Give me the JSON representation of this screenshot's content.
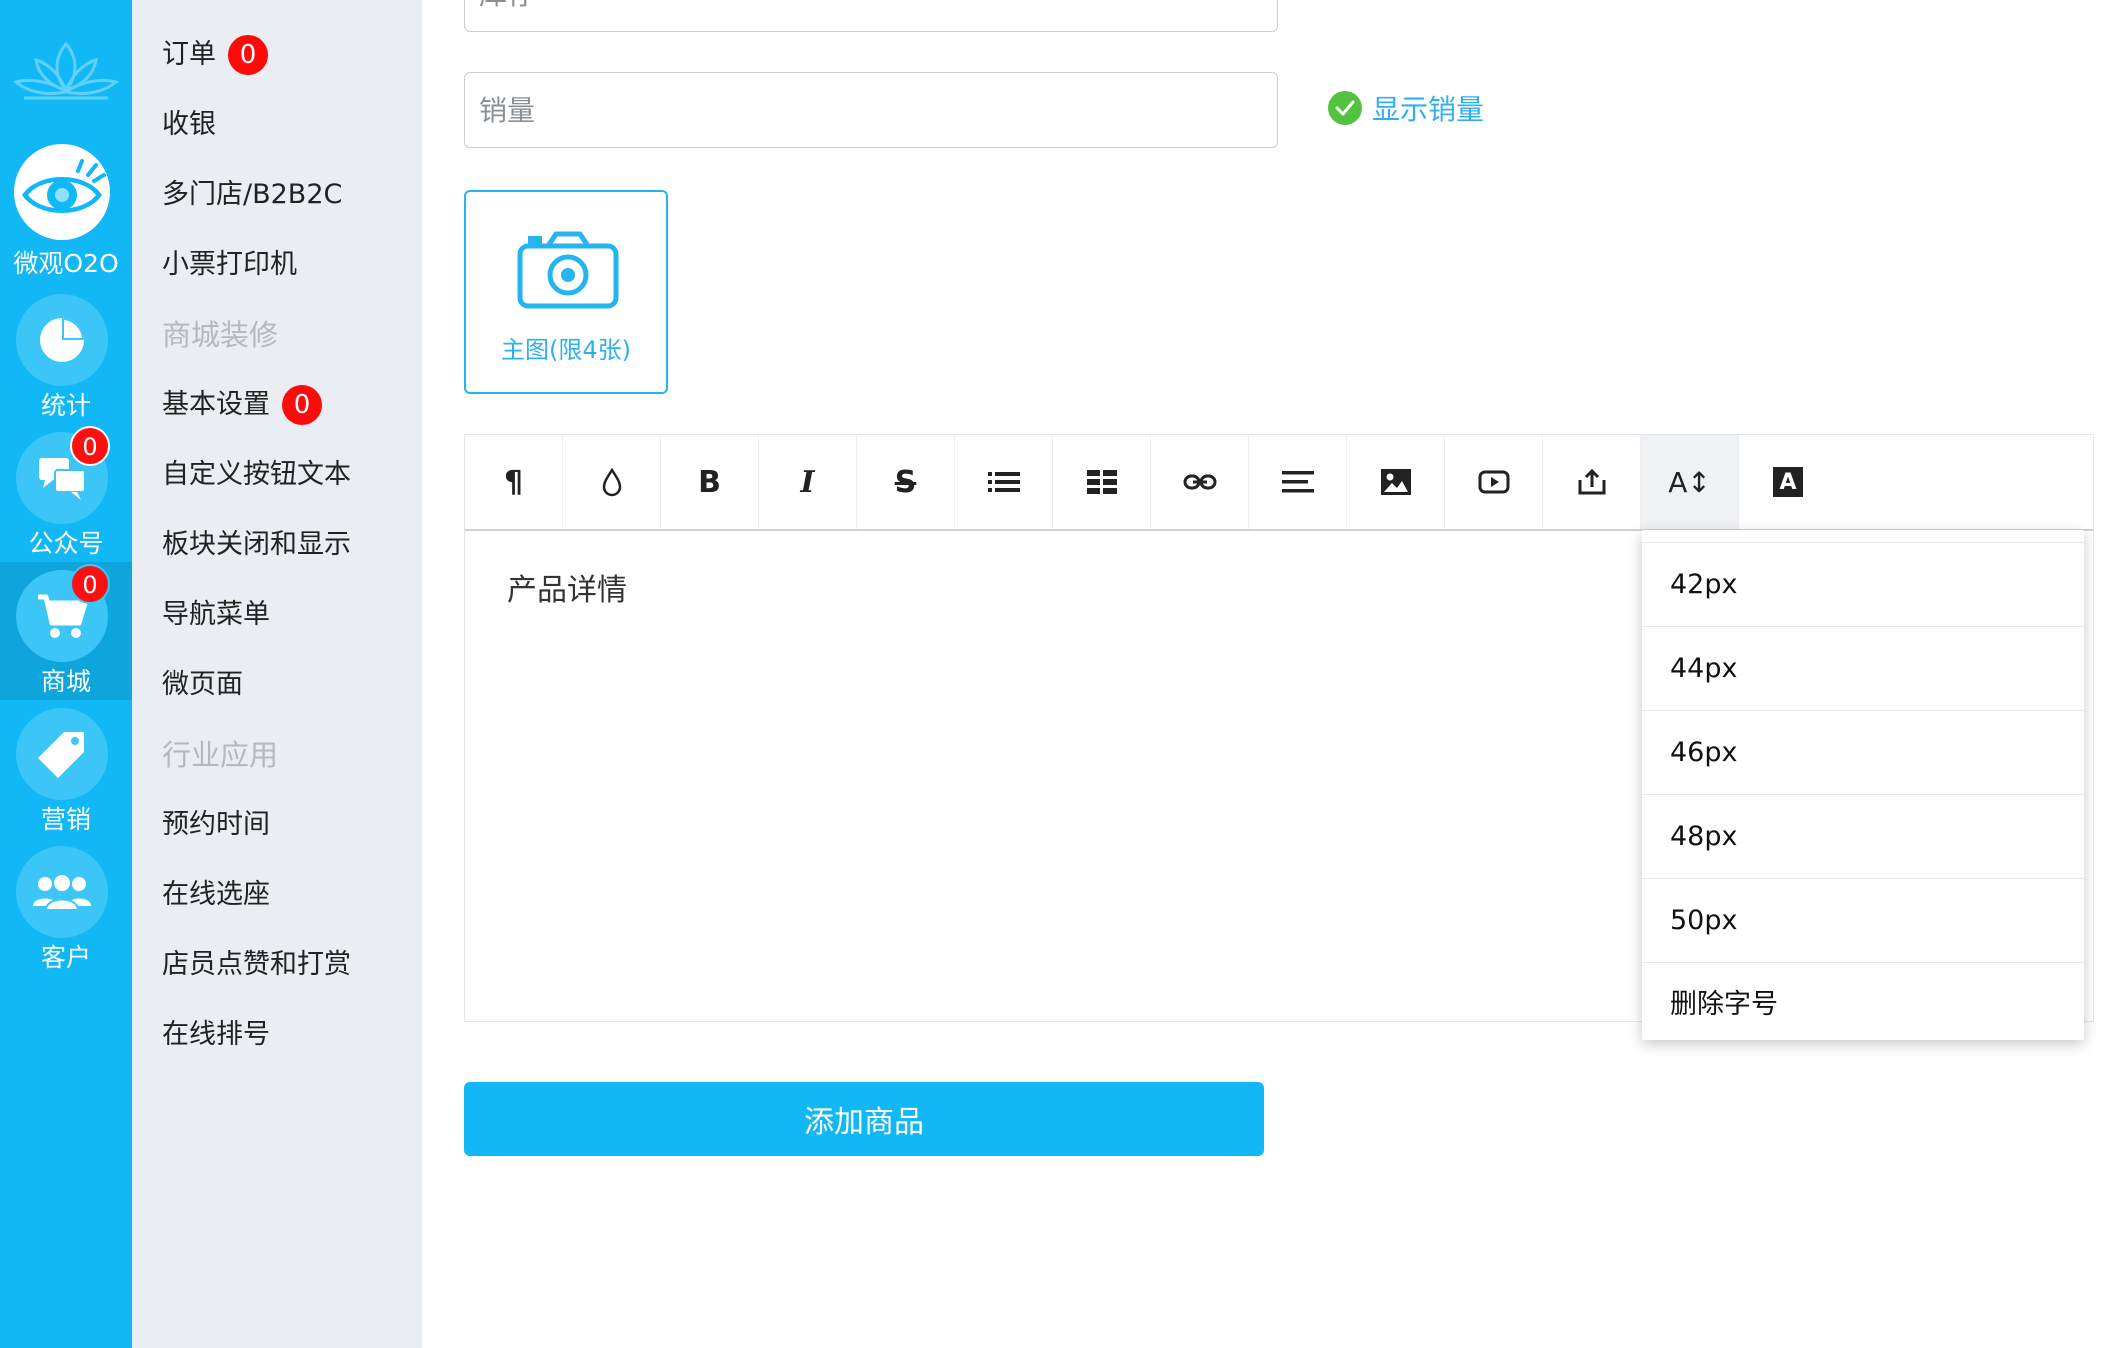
{
  "rail": {
    "items": [
      {
        "label": "微观O2O",
        "icon": "eye-logo-icon"
      },
      {
        "label": "统计",
        "icon": "pie-chart-icon"
      },
      {
        "label": "公众号",
        "icon": "chat-bubbles-icon",
        "badge": "0"
      },
      {
        "label": "商城",
        "icon": "shopping-cart-icon",
        "badge": "0"
      },
      {
        "label": "营销",
        "icon": "tag-icon"
      },
      {
        "label": "客户",
        "icon": "users-icon"
      }
    ]
  },
  "menu": {
    "items": [
      {
        "label": "订单",
        "badge": "0"
      },
      {
        "label": "收银"
      },
      {
        "label": "多门店/B2B2C"
      },
      {
        "label": "小票打印机"
      },
      {
        "label": "商城装修"
      },
      {
        "label": "基本设置",
        "badge": "0"
      },
      {
        "label": "自定义按钮文本"
      },
      {
        "label": "板块关闭和显示"
      },
      {
        "label": "导航菜单"
      },
      {
        "label": "微页面"
      },
      {
        "label": "行业应用"
      },
      {
        "label": "预约时间"
      },
      {
        "label": "在线选座"
      },
      {
        "label": "店员点赞和打赏"
      },
      {
        "label": "在线排号"
      }
    ]
  },
  "form": {
    "stock_placeholder": "库存",
    "sales_placeholder": "销量",
    "show_sales_label": "显示销量",
    "main_image_label": "主图(限4张)"
  },
  "editor": {
    "toolbar_icons": [
      "paragraph-icon",
      "color-drop-icon",
      "bold-icon",
      "italic-icon",
      "strikethrough-icon",
      "list-icon",
      "table-icon",
      "link-icon",
      "align-icon",
      "image-icon",
      "video-icon",
      "upload-icon",
      "font-size-icon",
      "font-color-icon"
    ],
    "toolbar_text": {
      "bold": "B",
      "italic": "I",
      "strike": "S",
      "paragraph": "¶",
      "font_size": "A↕",
      "font_color": "A"
    },
    "body_text": "产品详情"
  },
  "font_size_menu": {
    "options": [
      "42px",
      "44px",
      "46px",
      "48px",
      "50px",
      "删除字号"
    ]
  },
  "submit_label": "添加商品",
  "colors": {
    "primary": "#12b7f5",
    "rail_active": "#0ea5dc",
    "menu_bg": "#eaedf1",
    "badge": "#ff0a0a",
    "check_green": "#51c33e"
  }
}
